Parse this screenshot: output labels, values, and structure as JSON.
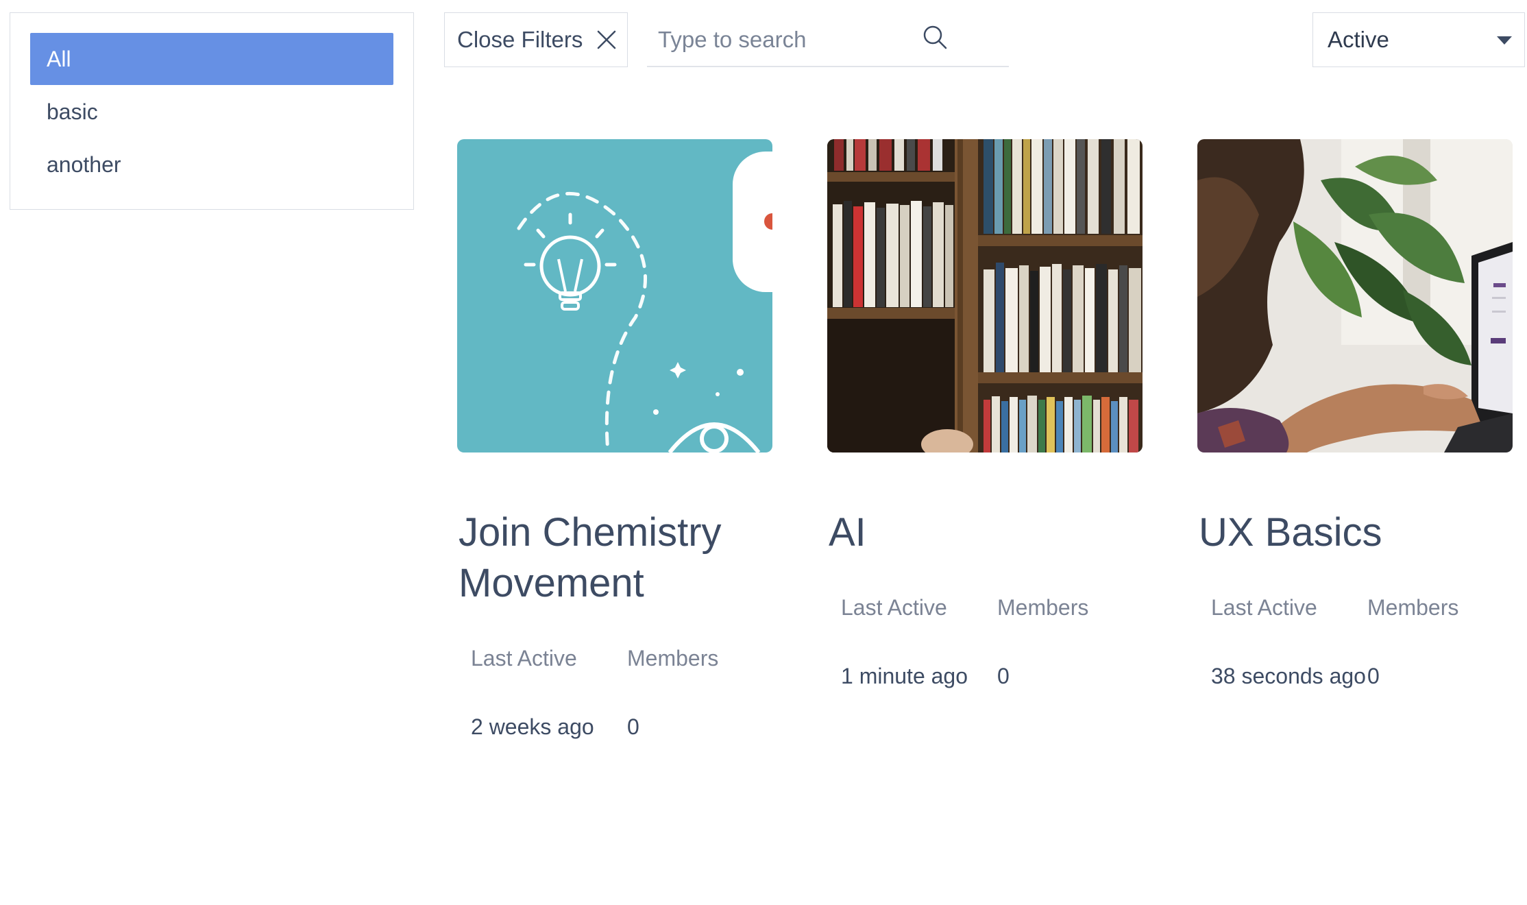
{
  "sidebar": {
    "items": [
      {
        "label": "All"
      },
      {
        "label": "basic"
      },
      {
        "label": "another"
      }
    ]
  },
  "toolbar": {
    "close_filters_label": "Close Filters",
    "search_placeholder": "Type to search",
    "search_value": "",
    "status_selected": "Active"
  },
  "colors": {
    "accent": "#6690e4",
    "text": "#3d4b63",
    "muted": "#7b8394",
    "border": "#d9dde4"
  },
  "cards": [
    {
      "title": "Join Chemistry Movement",
      "last_active_label": "Last Active",
      "members_label": "Members",
      "last_active": "2 weeks ago",
      "members": "0"
    },
    {
      "title": "AI",
      "last_active_label": "Last Active",
      "members_label": "Members",
      "last_active": "1 minute ago",
      "members": "0"
    },
    {
      "title": "UX Basics",
      "last_active_label": "Last Active",
      "members_label": "Members",
      "last_active": "38 seconds ago",
      "members": "0"
    }
  ]
}
